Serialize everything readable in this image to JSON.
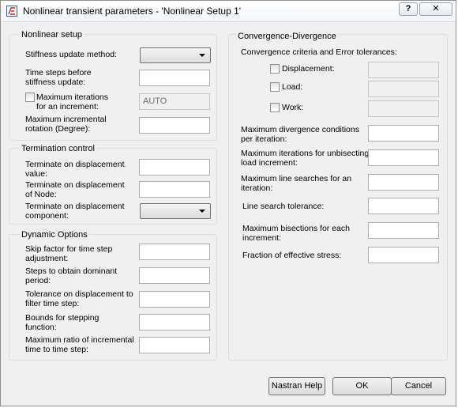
{
  "window": {
    "title": "Nonlinear transient parameters - 'Nonlinear Setup 1'",
    "help_label": "?",
    "close_label": "✕"
  },
  "nonlinear_setup": {
    "title": "Nonlinear setup",
    "stiffness_update_method_label": "Stiffness update method:",
    "stiffness_update_method_value": "",
    "time_steps_label_1": "Time steps before",
    "time_steps_label_2": "stiffness update:",
    "time_steps_value": "",
    "max_iterations_label_1": "Maximum iterations",
    "max_iterations_label_2": "for an increment:",
    "max_iterations_value": "AUTO",
    "max_incremental_rotation_label_1": "Maximum incremental",
    "max_incremental_rotation_label_2": "rotation (Degree):",
    "max_incremental_rotation_value": ""
  },
  "termination_control": {
    "title": "Termination control",
    "disp_value_label_1": "Terminate on displacement",
    "disp_value_label_2": "value:",
    "disp_value_value": "",
    "disp_node_label_1": "Terminate on displacement",
    "disp_node_label_2": "of Node:",
    "disp_node_value": "",
    "disp_component_label_1": "Terminate on displacement",
    "disp_component_label_2": "component:",
    "disp_component_value": ""
  },
  "dynamic_options": {
    "title": "Dynamic Options",
    "skip_factor_label_1": "Skip factor for time step",
    "skip_factor_label_2": "adjustment:",
    "skip_factor_value": "",
    "steps_dominant_label_1": "Steps to obtain dominant",
    "steps_dominant_label_2": "period:",
    "steps_dominant_value": "",
    "tolerance_disp_label_1": "Tolerance on displacement to",
    "tolerance_disp_label_2": "filter time step:",
    "tolerance_disp_value": "",
    "bounds_stepping_label_1": "Bounds for stepping",
    "bounds_stepping_label_2": "function:",
    "bounds_stepping_value": "",
    "max_ratio_label_1": "Maximum ratio of incremental",
    "max_ratio_label_2": "time to time step:",
    "max_ratio_value": ""
  },
  "convergence": {
    "title": "Convergence-Divergence",
    "criteria_label": "Convergence criteria and Error tolerances:",
    "displacement_label": "Displacement:",
    "displacement_value": "",
    "load_label": "Load:",
    "load_value": "",
    "work_label": "Work:",
    "work_value": "",
    "max_divergence_label_1": "Maximum divergence conditions",
    "max_divergence_label_2": "per iteration:",
    "max_divergence_value": "",
    "max_iter_unbisecting_label_1": "Maximum iterations for unbisecting",
    "max_iter_unbisecting_label_2": "load increment:",
    "max_iter_unbisecting_value": "",
    "max_line_searches_label_1": "Maximum line searches for an",
    "max_line_searches_label_2": "iteration:",
    "max_line_searches_value": "",
    "line_search_tolerance_label": "Line search tolerance:",
    "line_search_tolerance_value": "",
    "max_bisections_label_1": "Maximum bisections for each",
    "max_bisections_label_2": "increment:",
    "max_bisections_value": "",
    "fraction_effective_stress_label": "Fraction of effective stress:",
    "fraction_effective_stress_value": ""
  },
  "footer": {
    "nastran_help_label": "Nastran Help",
    "ok_label": "OK",
    "cancel_label": "Cancel"
  }
}
